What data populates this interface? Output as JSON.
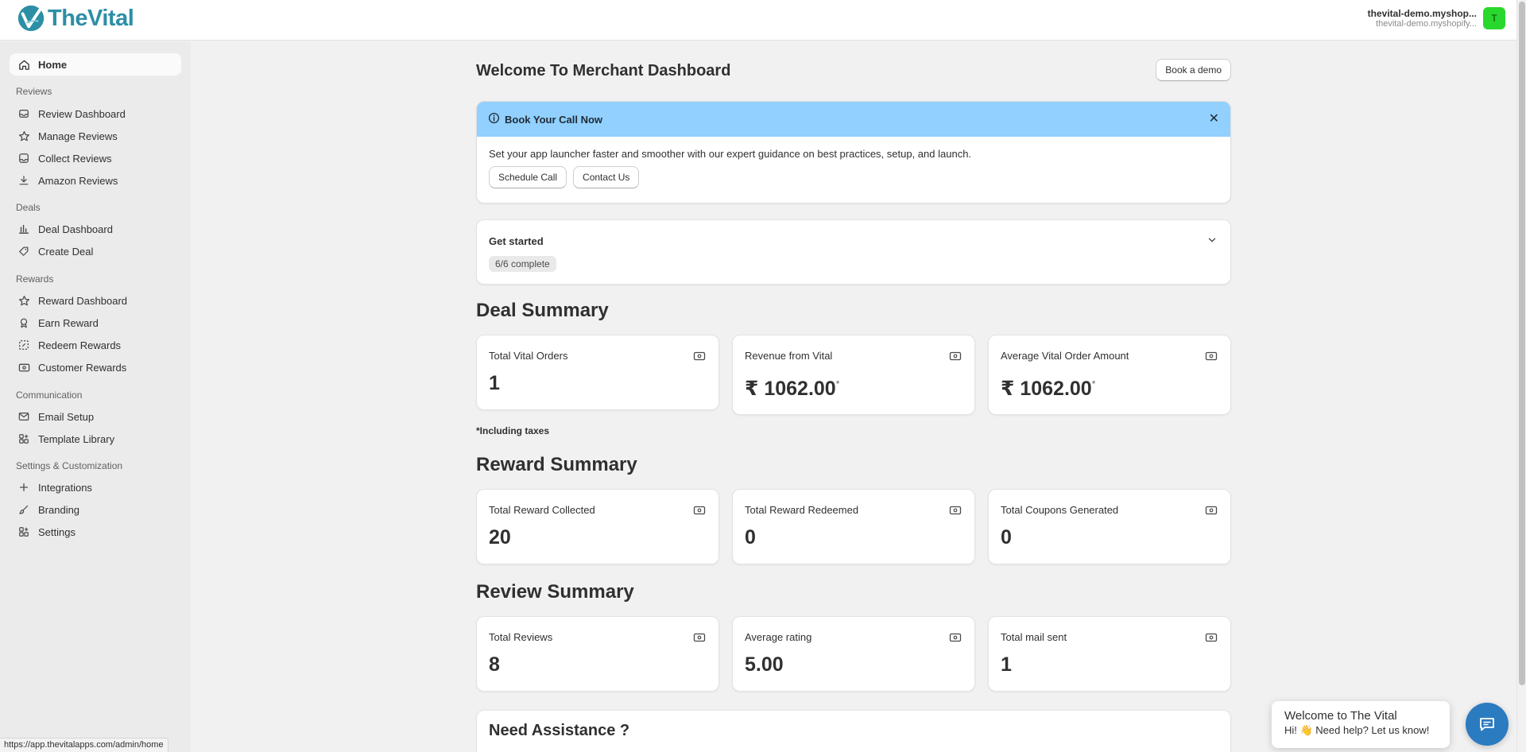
{
  "brand": {
    "name": "TheVital",
    "color": "#2c8fa6"
  },
  "store": {
    "name": "thevital-demo.myshop...",
    "url": "thevital-demo.myshopify...",
    "avatar": "T",
    "avatar_color": "#29d82c"
  },
  "sidebar": {
    "home": "Home",
    "sections": [
      {
        "title": "Reviews",
        "items": [
          {
            "label": "Review Dashboard",
            "icon": "inbox-icon"
          },
          {
            "label": "Manage Reviews",
            "icon": "star-icon"
          },
          {
            "label": "Collect Reviews",
            "icon": "collect-icon"
          },
          {
            "label": "Amazon Reviews",
            "icon": "download-icon"
          }
        ]
      },
      {
        "title": "Deals",
        "items": [
          {
            "label": "Deal Dashboard",
            "icon": "bar-chart-icon"
          },
          {
            "label": "Create Deal",
            "icon": "tag-plus-icon"
          }
        ]
      },
      {
        "title": "Rewards",
        "items": [
          {
            "label": "Reward Dashboard",
            "icon": "star-icon"
          },
          {
            "label": "Earn Reward",
            "icon": "badge-icon"
          },
          {
            "label": "Redeem Rewards",
            "icon": "redeem-icon"
          },
          {
            "label": "Customer Rewards",
            "icon": "cash-icon"
          }
        ]
      },
      {
        "title": "Communication",
        "items": [
          {
            "label": "Email Setup",
            "icon": "mail-icon"
          },
          {
            "label": "Template Library",
            "icon": "apps-icon"
          }
        ]
      },
      {
        "title": "Settings & Customization",
        "items": [
          {
            "label": "Integrations",
            "icon": "plus-icon"
          },
          {
            "label": "Branding",
            "icon": "brush-icon"
          },
          {
            "label": "Settings",
            "icon": "apps-icon"
          }
        ]
      }
    ]
  },
  "main": {
    "title": "Welcome To Merchant Dashboard",
    "book_demo": "Book a demo",
    "banner": {
      "title": "Book Your Call Now",
      "text": "Set your app launcher faster and smoother with our expert guidance on best practices, setup, and launch.",
      "schedule_call": "Schedule Call",
      "contact_us": "Contact Us",
      "bg_color": "#91d0ff"
    },
    "get_started": {
      "title": "Get started",
      "progress": "6/6 complete"
    },
    "deal_summary": {
      "title": "Deal Summary",
      "cards": [
        {
          "label": "Total Vital Orders",
          "value": "1",
          "note": ""
        },
        {
          "label": "Revenue from Vital",
          "value": "₹ 1062.00",
          "note": "*"
        },
        {
          "label": "Average Vital Order Amount",
          "value": "₹ 1062.00",
          "note": "*"
        }
      ],
      "tax_note": "*Including taxes"
    },
    "reward_summary": {
      "title": "Reward Summary",
      "cards": [
        {
          "label": "Total Reward Collected",
          "value": "20"
        },
        {
          "label": "Total Reward Redeemed",
          "value": "0"
        },
        {
          "label": "Total Coupons Generated",
          "value": "0"
        }
      ]
    },
    "review_summary": {
      "title": "Review Summary",
      "cards": [
        {
          "label": "Total Reviews",
          "value": "8"
        },
        {
          "label": "Average rating",
          "value": "5.00"
        },
        {
          "label": "Total mail sent",
          "value": "1"
        }
      ]
    },
    "assistance": {
      "title": "Need Assistance ?"
    }
  },
  "status_url": "https://app.thevitalapps.com/admin/home",
  "chat": {
    "title": "Welcome to The Vital",
    "subtitle": "Hi! 👋 Need help? Let us know!",
    "button_color": "#2b7bc0"
  }
}
